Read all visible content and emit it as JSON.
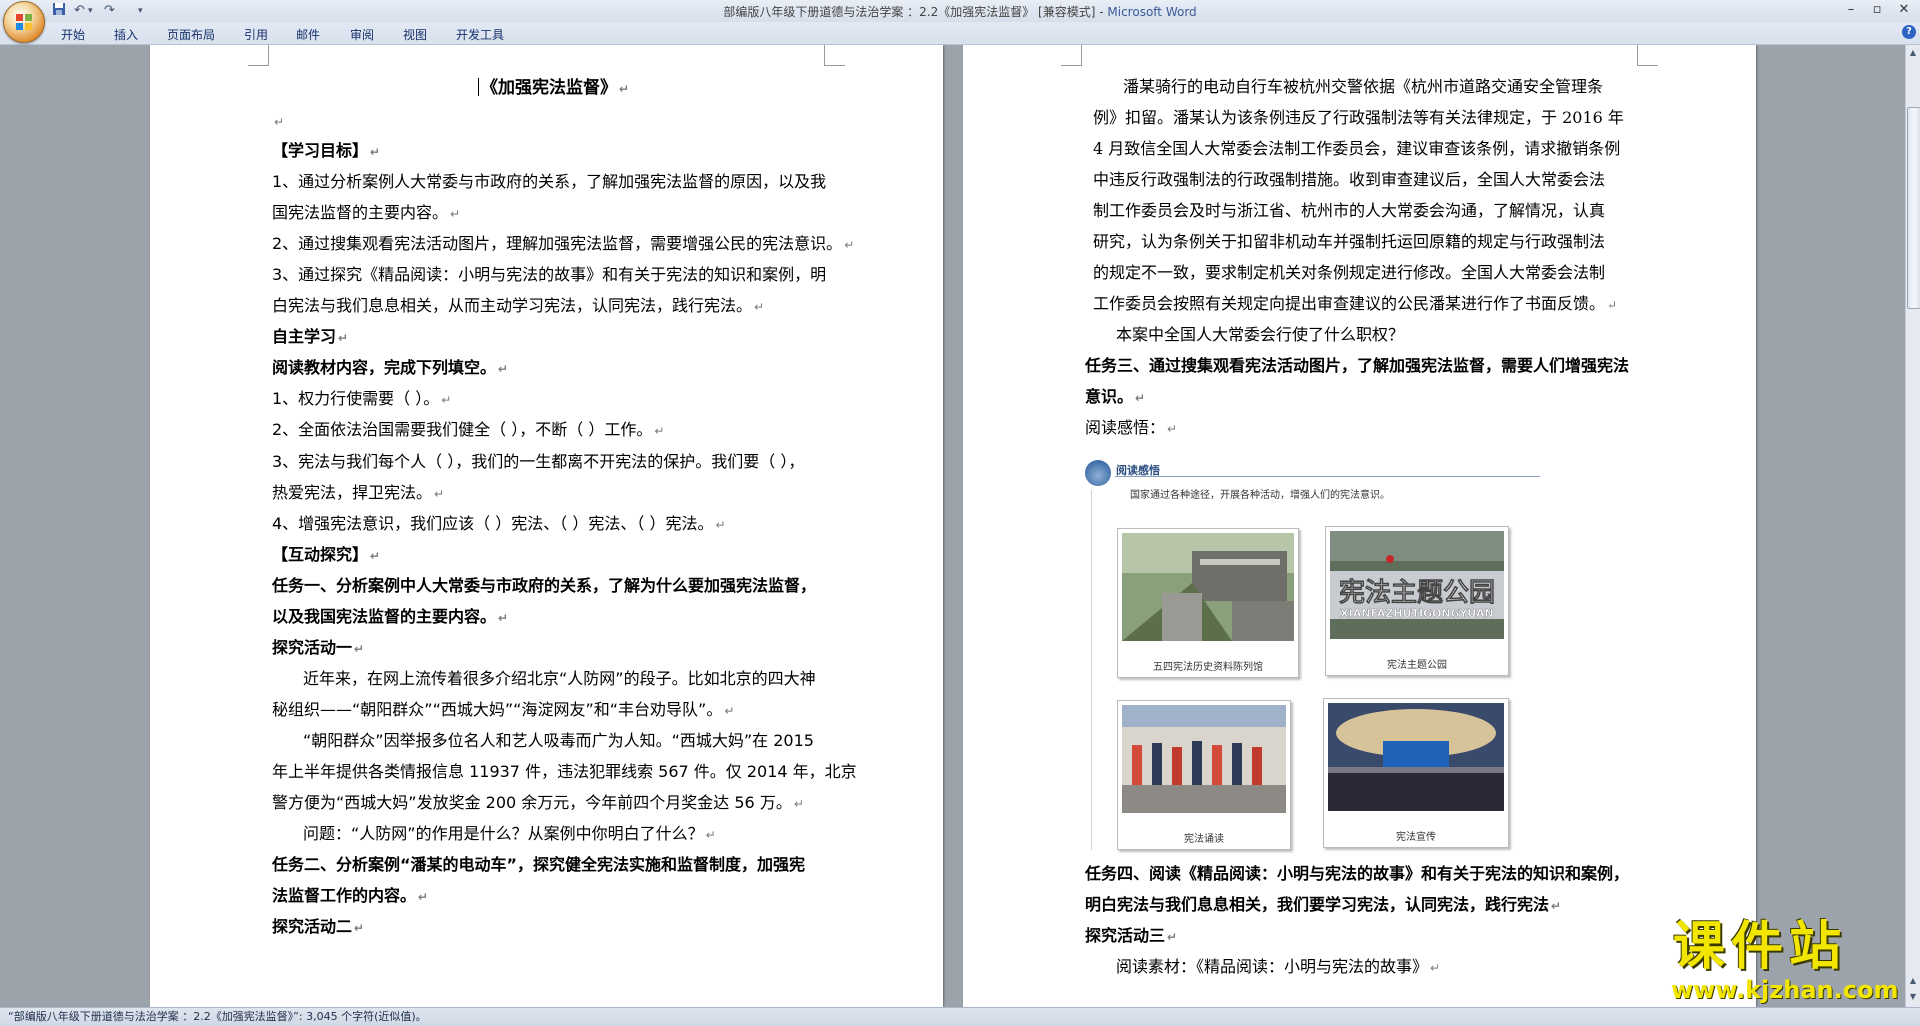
{
  "window": {
    "title": "部编版八年级下册道德与法治学案 ：2.2《加强宪法监督》 [兼容模式]",
    "app_name": "Microsoft Word"
  },
  "ribbon": {
    "tabs": [
      "开始",
      "插入",
      "页面布局",
      "引用",
      "邮件",
      "审阅",
      "视图",
      "开发工具"
    ]
  },
  "doc": {
    "left": {
      "title": "《加强宪法监督》",
      "lines": [
        "【学习目标】",
        "1、通过分析案例人大常委与市政府的关系，了解加强宪法监督的原因，以及我",
        "国宪法监督的主要内容。",
        "2、通过搜集观看宪法活动图片，理解加强宪法监督，需要增强公民的宪法意识。",
        "3、通过探究《精品阅读：小明与宪法的故事》和有关于宪法的知识和案例，明",
        "白宪法与我们息息相关，从而主动学习宪法，认同宪法，践行宪法。",
        "自主学习",
        "阅读教材内容，完成下列填空。",
        "1、权力行使需要（      ）。",
        "2、全面依法治国需要我们健全（      ），不断（      ）工作。",
        "3、宪法与我们每个人（      ），我们的一生都离不开宪法的保护。我们要（      ），",
        "热爱宪法，捍卫宪法。",
        "4、增强宪法意识，我们应该（      ）宪法、（      ）宪法、（      ）宪法。",
        "【互动探究】",
        "任务一、分析案例中人大常委与市政府的关系，了解为什么要加强宪法监督，",
        "以及我国宪法监督的主要内容。",
        "探究活动一",
        "近年来，在网上流传着很多介绍北京“人防网”的段子。比如北京的四大神",
        "秘组织——“朝阳群众”“西城大妈”“海淀网友”和“丰台劝导队”。",
        "“朝阳群众”因举报多位名人和艺人吸毒而广为人知。“西城大妈”在 2015",
        "年上半年提供各类情报信息 11937 件，违法犯罪线索 567 件。仅 2014 年，北京",
        "警方便为“西城大妈”发放奖金 200 余万元，今年前四个月奖金达 56 万。",
        "问题：“人防网”的作用是什么？从案例中你明白了什么？",
        "任务二、分析案例“潘某的电动车”，探究健全宪法实施和监督制度，加强宪",
        "法监督工作的内容。",
        "探究活动二"
      ]
    },
    "right": {
      "lines": [
        "潘某骑行的电动自行车被杭州交警依据《杭州市道路交通安全管理条",
        "例》扣留。潘某认为该条例违反了行政强制法等有关法律规定，于 2016 年",
        "4 月致信全国人大常委会法制工作委员会，建议审查该条例，请求撤销条例",
        "中违反行政强制法的行政强制措施。收到审查建议后，全国人大常委会法",
        "制工作委员会及时与浙江省、杭州市的人大常委会沟通，了解情况，认真",
        "研究，认为条例关于扣留非机动车并强制托运回原籍的规定与行政强制法",
        "的规定不一致，要求制定机关对条例规定进行修改。全国人大常委会法制",
        "工作委员会按照有关规定向提出审查建议的公民潘某进行作了书面反馈。",
        "本案中全国人大常委会行使了什么职权？",
        "任务三、通过搜集观看宪法活动图片，了解加强宪法监督，需要人们增强宪法",
        "意识。",
        "阅读感悟：",
        "任务四、阅读《精品阅读：小明与宪法的故事》和有关于宪法的知识和案例，",
        "明白宪法与我们息息相关，我们要学习宪法，认同宪法，践行宪法",
        "探究活动三",
        "阅读素材：《精品阅读：小明与宪法的故事》"
      ],
      "figure": {
        "title": "阅读感悟",
        "subtitle": "国家通过各种途径，开展各种活动，增强人们的宪法意识。",
        "photo_text": "宪法主题公园",
        "photo_text_latin": "XIANFAZHUTIGONGYUAN",
        "captions": [
          "五四宪法历史资料陈列馆",
          "宪法主题公园",
          "宪法诵读",
          "宪法宣传"
        ]
      }
    }
  },
  "status": {
    "text": "“部编版八年级下册道德与法治学案 ：2.2《加强宪法监督》”: 3,045 个字符(近似值)。"
  },
  "watermark": {
    "cn": "课件站",
    "url": "www.kjzhan.com"
  },
  "colors": {
    "workspace": "#9da3ab",
    "title_accent": "#3a5a9a",
    "watermark": "#f2e600"
  }
}
